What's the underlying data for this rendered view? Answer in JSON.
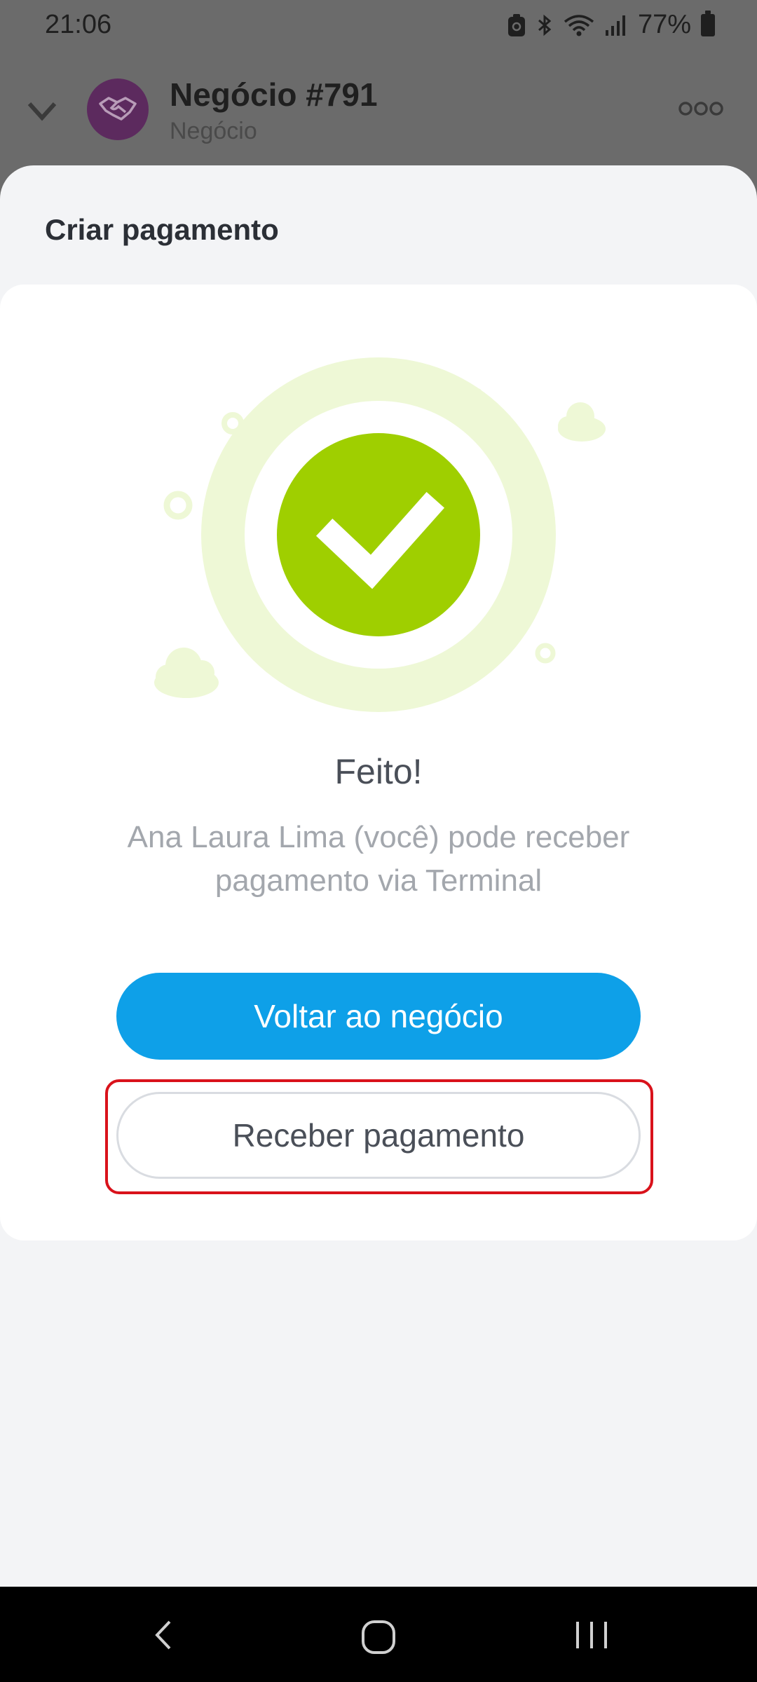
{
  "status_bar": {
    "time": "21:06",
    "battery": "77%",
    "icons": [
      "app-notification-icon",
      "bluetooth-icon",
      "wifi-icon",
      "signal-icon",
      "battery-icon"
    ]
  },
  "header": {
    "title": "Negócio #791",
    "subtitle": "Negócio",
    "collapse_icon": "chevron-down-icon",
    "avatar_icon": "handshake-icon",
    "more_icon": "more-options-icon"
  },
  "sheet": {
    "title": "Criar pagamento",
    "success_icon": "check-icon",
    "done_title": "Feito!",
    "description": "Ana Laura Lima (você) pode receber pagamento via Terminal",
    "primary_button": "Voltar ao negócio",
    "secondary_button": "Receber pagamento"
  },
  "colors": {
    "accent": "#0ea0e8",
    "success": "#9fcf00",
    "success_light": "#eef8d6",
    "avatar": "#5c2a5e",
    "highlight": "#d9121b"
  },
  "nav_bar": {
    "icons": [
      "back-icon",
      "home-icon",
      "recent-apps-icon"
    ]
  }
}
